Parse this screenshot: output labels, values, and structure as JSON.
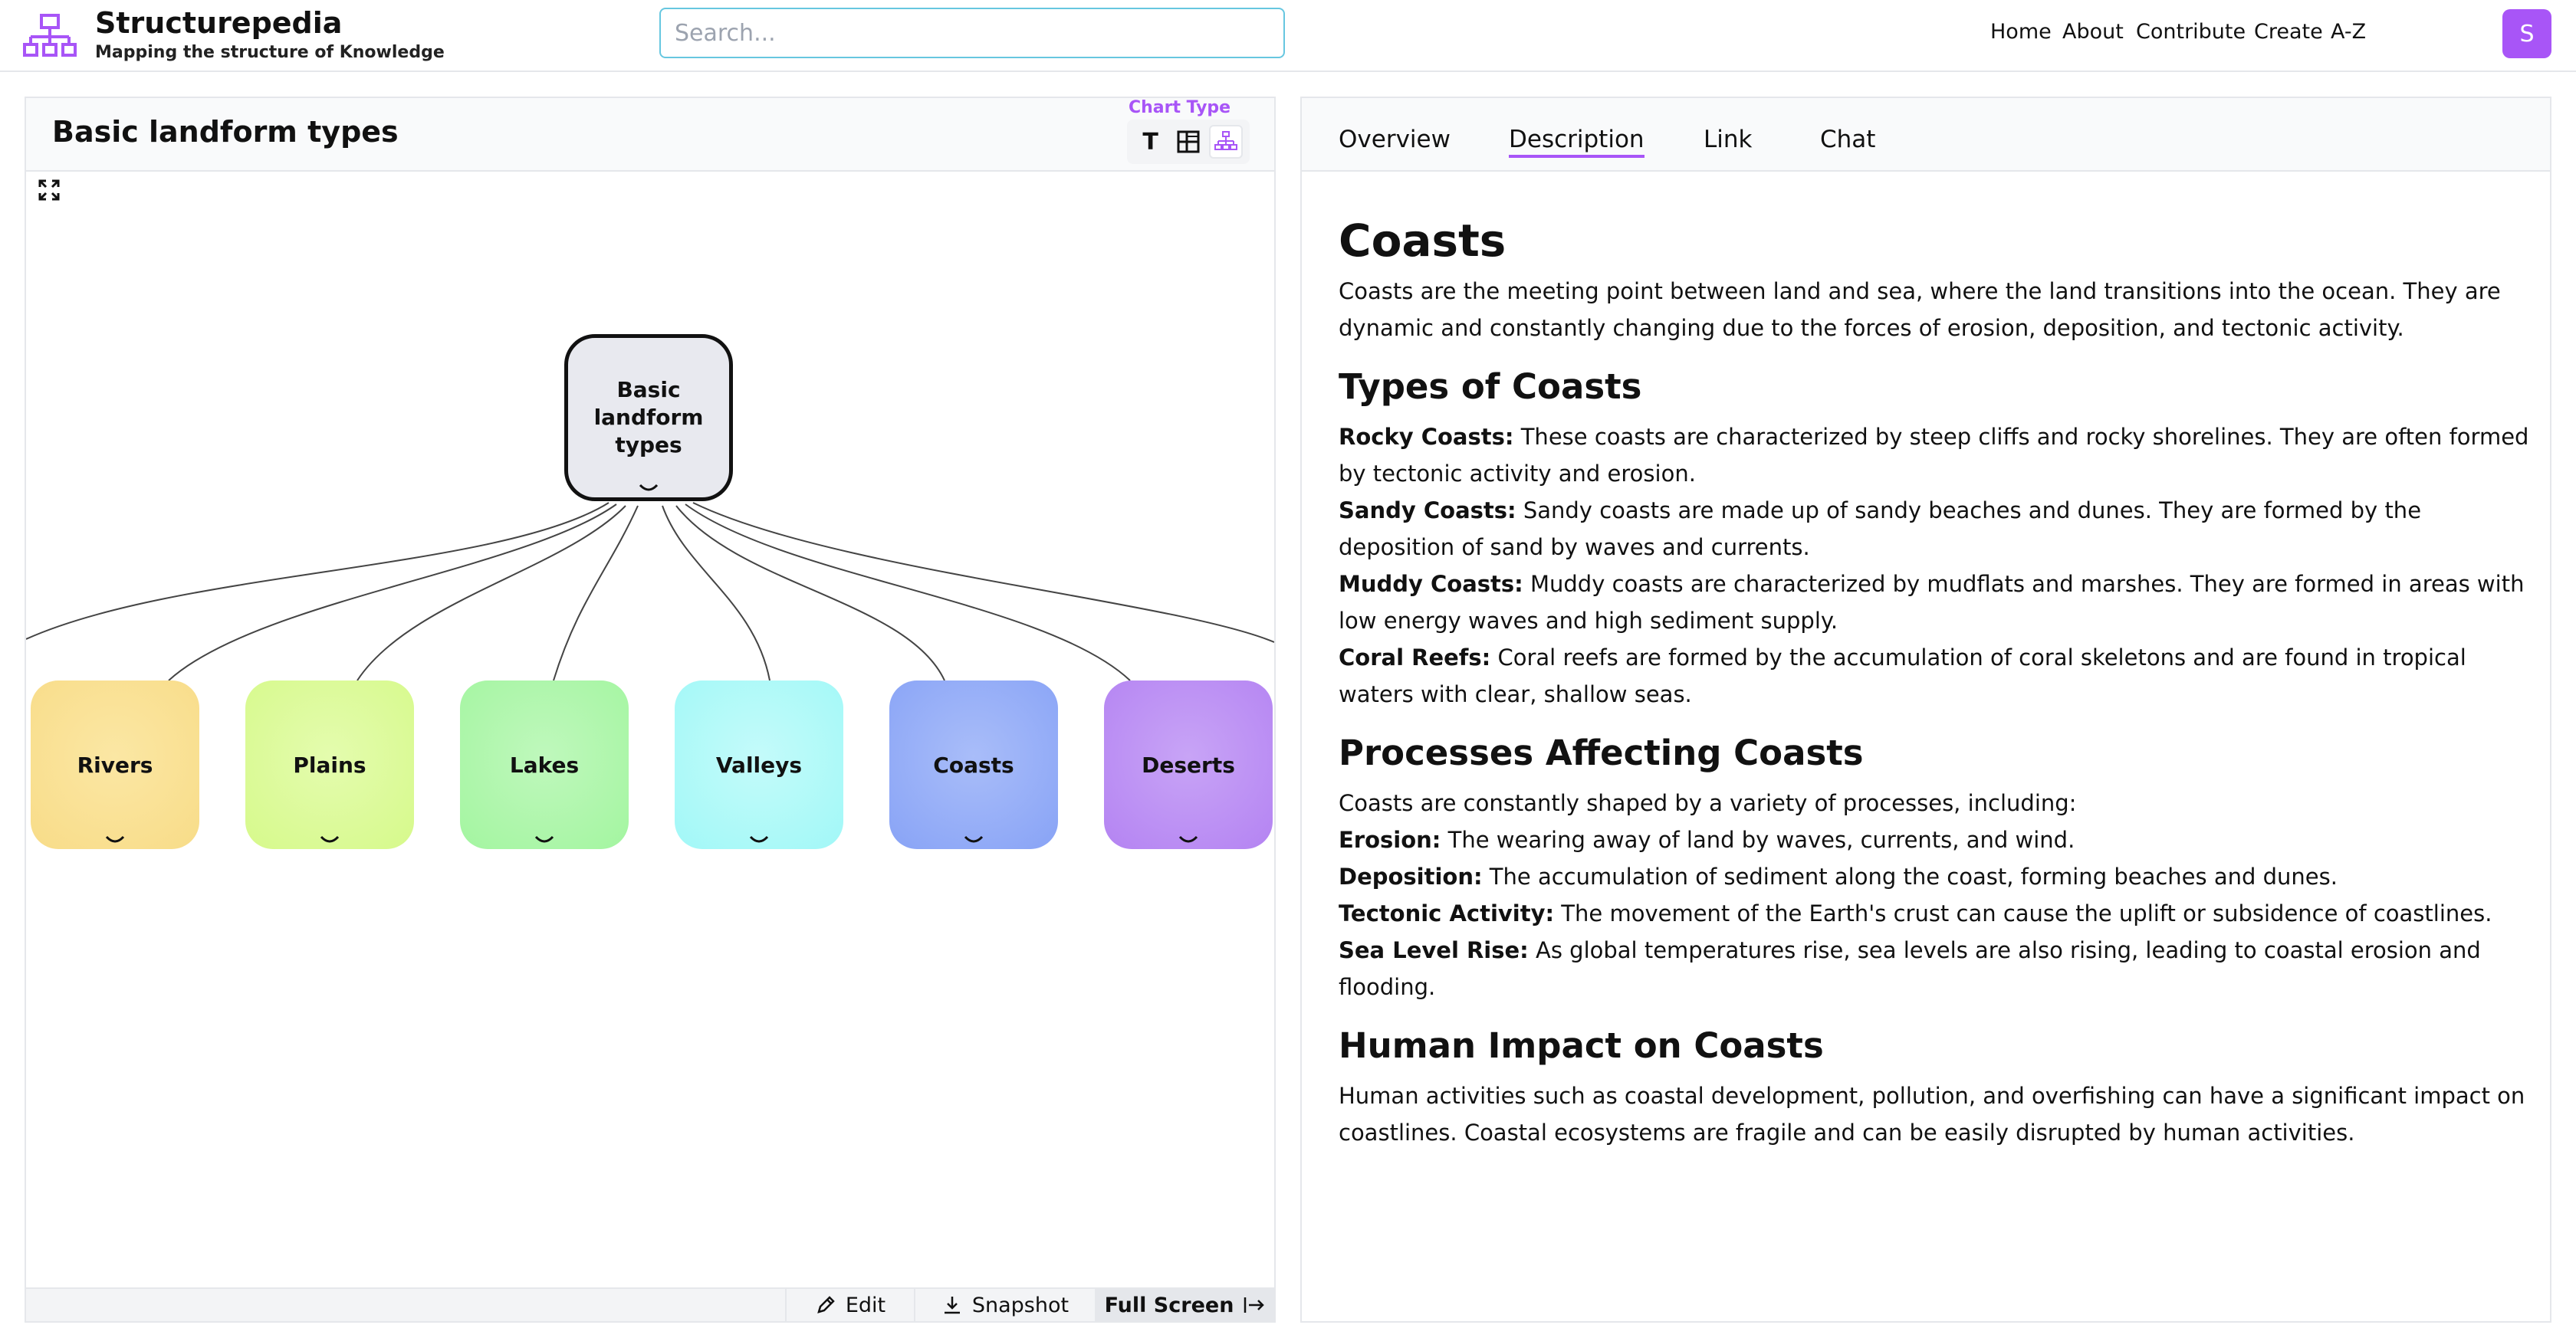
{
  "app": {
    "title": "Structurepedia",
    "subtitle": "Mapping the structure of Knowledge",
    "search_placeholder": "Search...",
    "nav": [
      "Home",
      "About",
      "Contribute",
      "Create",
      "A-Z"
    ],
    "avatar_letter": "S",
    "accent_color": "#a855f7"
  },
  "chart_panel": {
    "title": "Basic landform types",
    "chart_type_label": "Chart Type",
    "chart_type_options": [
      "text-icon",
      "grid-icon",
      "hierarchy-icon"
    ],
    "chart_type_selected": "hierarchy-icon",
    "root": "Basic landform types",
    "children": [
      {
        "label": "Rivers",
        "color": "#f8dc88"
      },
      {
        "label": "Plains",
        "color": "#d6f98b"
      },
      {
        "label": "Lakes",
        "color": "#a3f5a0"
      },
      {
        "label": "Valleys",
        "color": "#a1f8f7"
      },
      {
        "label": "Coasts",
        "color": "#88a3f6"
      },
      {
        "label": "Deserts",
        "color": "#b483f2"
      }
    ],
    "bottom_buttons": {
      "edit": "Edit",
      "snapshot": "Snapshot",
      "fullscreen": "Full Screen"
    }
  },
  "detail_panel": {
    "tabs": [
      "Overview",
      "Description",
      "Link",
      "Chat"
    ],
    "active_tab": "Description",
    "heading": "Coasts",
    "intro": "Coasts are the meeting point between land and sea, where the land transitions into the ocean. They are dynamic and constantly changing due to the forces of erosion, deposition, and tectonic activity.",
    "types_heading": "Types of Coasts",
    "types": [
      {
        "term": "Rocky Coasts:",
        "text": " These coasts are characterized by steep cliffs and rocky shorelines. They are often formed by tectonic activity and erosion."
      },
      {
        "term": "Sandy Coasts:",
        "text": " Sandy coasts are made up of sandy beaches and dunes. They are formed by the deposition of sand by waves and currents."
      },
      {
        "term": "Muddy Coasts:",
        "text": " Muddy coasts are characterized by mudflats and marshes. They are formed in areas with low energy waves and high sediment supply."
      },
      {
        "term": "Coral Reefs:",
        "text": " Coral reefs are formed by the accumulation of coral skeletons and are found in tropical waters with clear, shallow seas."
      }
    ],
    "processes_heading": "Processes Affecting Coasts",
    "processes_intro": "Coasts are constantly shaped by a variety of processes, including:",
    "processes": [
      {
        "term": "Erosion:",
        "text": " The wearing away of land by waves, currents, and wind."
      },
      {
        "term": "Deposition:",
        "text": " The accumulation of sediment along the coast, forming beaches and dunes."
      },
      {
        "term": "Tectonic Activity:",
        "text": " The movement of the Earth's crust can cause the uplift or subsidence of coastlines."
      },
      {
        "term": "Sea Level Rise:",
        "text": " As global temperatures rise, sea levels are also rising, leading to coastal erosion and flooding."
      }
    ],
    "human_heading": "Human Impact on Coasts",
    "human_text": "Human activities such as coastal development, pollution, and overfishing can have a significant impact on coastlines. Coastal ecosystems are fragile and can be easily disrupted by human activities."
  }
}
